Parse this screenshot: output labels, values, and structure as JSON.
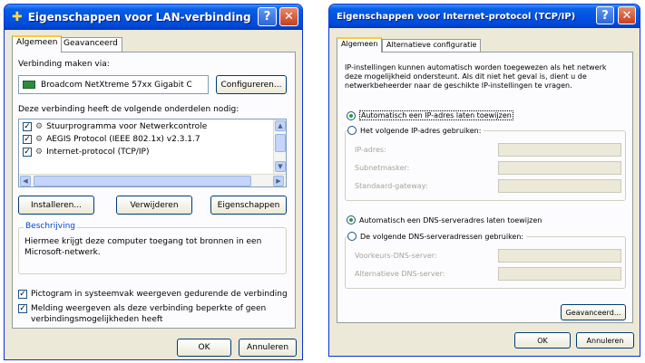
{
  "lan": {
    "title": "Eigenschappen voor LAN-verbinding",
    "tabs": [
      "Algemeen",
      "Geavanceerd"
    ],
    "connect_via_label": "Verbinding maken via:",
    "adapter_name": "Broadcom NetXtreme 57xx Gigabit C",
    "configure_label": "Configureren...",
    "components_label": "Deze verbinding heeft de volgende onderdelen nodig:",
    "components": [
      "Stuurprogramma voor Netwerkcontrole",
      "AEGIS Protocol (IEEE 802.1x) v2.3.1.7",
      "Internet-protocol (TCP/IP)"
    ],
    "install_label": "Installeren...",
    "remove_label": "Verwijderen",
    "properties_label": "Eigenschappen",
    "description_title": "Beschrijving",
    "description_text": "Hiermee krijgt deze computer toegang tot bronnen in een Microsoft-netwerk.",
    "show_icon_label": "Pictogram in systeemvak weergeven gedurende de verbinding",
    "notify_label": "Melding weergeven als deze verbinding beperkte of geen verbindingsmogelijkheden heeft",
    "ok_label": "OK",
    "cancel_label": "Annuleren"
  },
  "tcp": {
    "title": "Eigenschappen voor Internet-protocol (TCP/IP)",
    "tabs": [
      "Algemeen",
      "Alternatieve configuratie"
    ],
    "intro_text": "IP-instellingen kunnen automatisch worden toegewezen als het netwerk deze mogelijkheid ondersteunt. Als dit niet het geval is, dient u de netwerkbeheerder naar de geschikte IP-instellingen te vragen.",
    "auto_ip_label": "Automatisch een IP-adres laten toewijzen",
    "manual_ip_label": "Het volgende IP-adres gebruiken:",
    "ip_label": "IP-adres:",
    "subnet_label": "Subnetmasker:",
    "gateway_label": "Standaard-gateway:",
    "auto_dns_label": "Automatisch een DNS-serveradres laten toewijzen",
    "manual_dns_label": "De volgende DNS-serveradressen gebruiken:",
    "preferred_dns_label": "Voorkeurs-DNS-server:",
    "alternate_dns_label": "Alternatieve DNS-server:",
    "advanced_label": "Geavanceerd...",
    "ok_label": "OK",
    "cancel_label": "Annuleren"
  },
  "icons": {
    "title_icon": "network-connection-icon",
    "help": "?",
    "close": "✕",
    "adapter": "network-adapter-icon",
    "scroll_up": "▲",
    "scroll_down": "▼",
    "scroll_left": "◀",
    "scroll_right": "▶",
    "checkmark": "✓"
  }
}
